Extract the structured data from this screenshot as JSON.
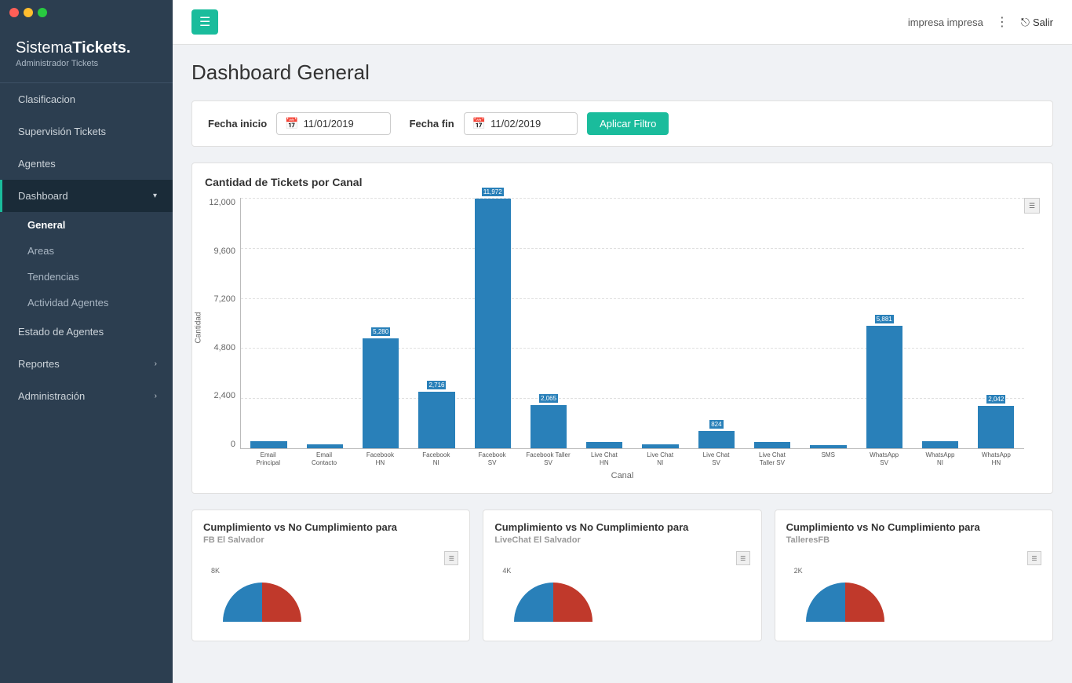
{
  "window": {
    "buttons": [
      "red",
      "yellow",
      "green"
    ]
  },
  "sidebar": {
    "logo": {
      "brand_light": "Sistema",
      "brand_bold": "Tickets.",
      "sub": "Administrador Tickets"
    },
    "items": [
      {
        "id": "clasificacion",
        "label": "Clasificacion",
        "active": false,
        "sub": false
      },
      {
        "id": "supervision",
        "label": "Supervisión Tickets",
        "active": false,
        "sub": false
      },
      {
        "id": "agentes",
        "label": "Agentes",
        "active": false,
        "sub": false
      },
      {
        "id": "dashboard",
        "label": "Dashboard",
        "active": true,
        "sub": true,
        "chevron": "▾",
        "children": [
          {
            "id": "general",
            "label": "General",
            "active": true
          },
          {
            "id": "areas",
            "label": "Areas",
            "active": false
          },
          {
            "id": "tendencias",
            "label": "Tendencias",
            "active": false
          },
          {
            "id": "actividad-agentes",
            "label": "Actividad Agentes",
            "active": false
          }
        ]
      },
      {
        "id": "estado-agentes",
        "label": "Estado de Agentes",
        "active": false,
        "sub": false
      },
      {
        "id": "reportes",
        "label": "Reportes",
        "active": false,
        "sub": false,
        "chevron": "›"
      },
      {
        "id": "administracion",
        "label": "Administración",
        "active": false,
        "sub": false,
        "chevron": "›"
      }
    ]
  },
  "topbar": {
    "menu_icon": "☰",
    "company": "impresa impresa",
    "menu_dots": "⋮",
    "logout_icon": "⎋",
    "logout_label": "Salir"
  },
  "page": {
    "title": "Dashboard General"
  },
  "filter": {
    "start_label": "Fecha inicio",
    "start_value": "11/01/2019",
    "end_label": "Fecha fin",
    "end_value": "11/02/2019",
    "apply_label": "Aplicar Filtro",
    "calendar_icon": "📅"
  },
  "bar_chart": {
    "title": "Cantidad de Tickets por Canal",
    "y_axis_label": "Cantidad",
    "x_axis_label": "Canal",
    "y_labels": [
      "12,000",
      "9,600",
      "7,200",
      "4,800",
      "2,400",
      "0"
    ],
    "bars": [
      {
        "label": "Email\nPrincipal",
        "value": 350,
        "display": ""
      },
      {
        "label": "Email\nContacto",
        "value": 200,
        "display": ""
      },
      {
        "label": "Facebook\nHN",
        "value": 5280,
        "display": "5,280"
      },
      {
        "label": "Facebook\nNI",
        "value": 2716,
        "display": "2,716"
      },
      {
        "label": "Facebook\nSV",
        "value": 11972,
        "display": "11,972"
      },
      {
        "label": "Facebook Taller\nSV",
        "value": 2065,
        "display": "2,065"
      },
      {
        "label": "Live Chat\nHN",
        "value": 300,
        "display": ""
      },
      {
        "label": "Live Chat\nNI",
        "value": 200,
        "display": ""
      },
      {
        "label": "Live Chat\nSV",
        "value": 824,
        "display": "824"
      },
      {
        "label": "Live Chat\nTaller SV",
        "value": 300,
        "display": ""
      },
      {
        "label": "SMS",
        "value": 150,
        "display": ""
      },
      {
        "label": "WhatsApp\nSV",
        "value": 5881,
        "display": "5,881"
      },
      {
        "label": "WhatsApp\nNI",
        "value": 350,
        "display": ""
      },
      {
        "label": "WhatsApp\nHN",
        "value": 2042,
        "display": "2,042"
      }
    ],
    "max_value": 12000
  },
  "bottom_cards": [
    {
      "id": "fb-el-salvador",
      "title": "Cumplimiento vs No Cumplimiento para",
      "subtitle": "FB El Salvador",
      "y_label_top": "8K",
      "y_label_mid": ""
    },
    {
      "id": "livechat-el-salvador",
      "title": "Cumplimiento vs No Cumplimiento para",
      "subtitle": "LiveChat El Salvador",
      "y_label_top": "4K",
      "y_label_mid": ""
    },
    {
      "id": "talleres-fb",
      "title": "Cumplimiento vs No Cumplimiento para",
      "subtitle": "TalleresFB",
      "y_label_top": "2K",
      "y_label_mid": ""
    }
  ]
}
